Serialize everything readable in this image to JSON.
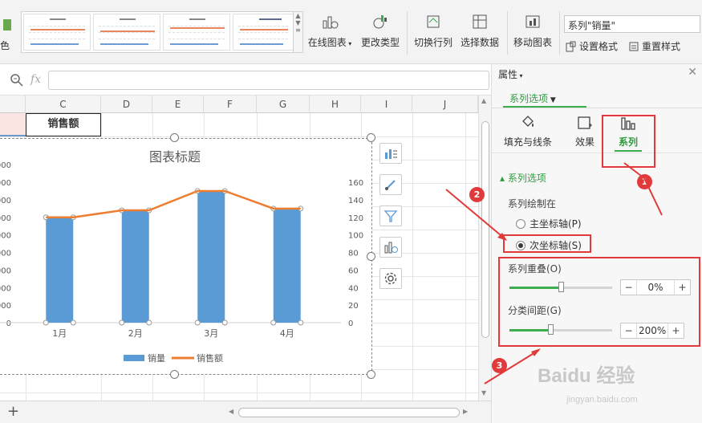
{
  "ribbon": {
    "color_label": "色",
    "online_chart": "在线图表",
    "change_type": "更改类型",
    "switch_row_col": "切换行列",
    "select_data": "选择数据",
    "move_chart": "移动图表",
    "series_selector": "系列\"销量\"",
    "set_format": "设置格式",
    "reset_style": "重置样式"
  },
  "formula_bar": {
    "fx_label": "fx",
    "value": ""
  },
  "sheet": {
    "columns": [
      "C",
      "D",
      "E",
      "F",
      "G",
      "H",
      "I",
      "J"
    ],
    "cell_c2": "销售额"
  },
  "chart_data": {
    "type": "bar",
    "title": "图表标题",
    "categories": [
      "1月",
      "2月",
      "3月",
      "4月"
    ],
    "series": [
      {
        "name": "销量",
        "type": "bar",
        "axis": "secondary",
        "values": [
          120,
          128,
          150,
          130
        ],
        "color": "#5b9bd5"
      },
      {
        "name": "销售额",
        "type": "line",
        "axis": "secondary",
        "values": [
          120,
          128,
          150,
          130
        ],
        "color": "#ed7d31"
      }
    ],
    "secondary_axis": {
      "min": 0,
      "max": 160,
      "ticks": [
        "0",
        "20",
        "40",
        "60",
        "80",
        "100",
        "120",
        "140",
        "160"
      ]
    },
    "primary_axis_visible_ticks": [
      "0",
      "000",
      "000",
      "000",
      "000",
      "000",
      "000",
      "000",
      "000",
      "000"
    ],
    "legend_position": "bottom"
  },
  "panel": {
    "title": "属性",
    "tab": "系列选项",
    "icons": {
      "fill_line": "填充与线条",
      "effect": "效果",
      "series": "系列"
    },
    "section": "系列选项",
    "plot_on": "系列绘制在",
    "primary_axis": "主坐标轴(P)",
    "secondary_axis": "次坐标轴(S)",
    "overlap_label": "系列重叠(O)",
    "overlap_value": "0%",
    "overlap_fraction": 0.5,
    "gap_label": "分类间距(G)",
    "gap_value": "200%",
    "gap_fraction": 0.4
  },
  "annotations": {
    "badge1": "1",
    "badge2": "2",
    "badge3": "3"
  },
  "watermark": {
    "main": "Baidu 经验",
    "sub": "jingyan.baidu.com"
  },
  "colors": {
    "accent_green": "#3cae4e",
    "annotation_red": "#e03a3a",
    "bar_blue": "#5b9bd5",
    "line_orange": "#ed7d31"
  }
}
